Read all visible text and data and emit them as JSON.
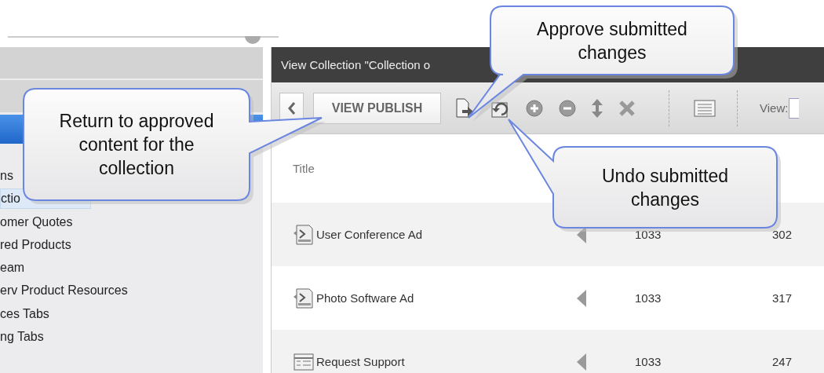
{
  "sidebar": {
    "items": [
      {
        "label": "ns",
        "selected": false
      },
      {
        "label": "ctio",
        "selected": true
      },
      {
        "label": "omer Quotes",
        "selected": false
      },
      {
        "label": "red Products",
        "selected": false
      },
      {
        "label": "eam",
        "selected": false
      },
      {
        "label": "erv Product Resources",
        "selected": false
      },
      {
        "label": "ces Tabs",
        "selected": false
      },
      {
        "label": "ng Tabs",
        "selected": false
      }
    ]
  },
  "panel": {
    "title": "View Collection \"Collection o",
    "toolbar": {
      "view_publish": "VIEW PUBLISH",
      "view_label": "View:"
    },
    "table": {
      "columns": [
        "Title"
      ],
      "rows": [
        {
          "kind": "ad",
          "title": "User Conference Ad",
          "column_2": "1033",
          "column_3": "302"
        },
        {
          "kind": "ad",
          "title": "Photo Software Ad",
          "column_2": "1033",
          "column_3": "317"
        },
        {
          "kind": "form",
          "title": "Request Support",
          "column_2": "1033",
          "column_3": "247"
        }
      ]
    }
  },
  "callouts": [
    {
      "text": "Return to approved content for the collection"
    },
    {
      "text": "Approve submitted changes"
    },
    {
      "text": "Undo submitted changes"
    }
  ]
}
